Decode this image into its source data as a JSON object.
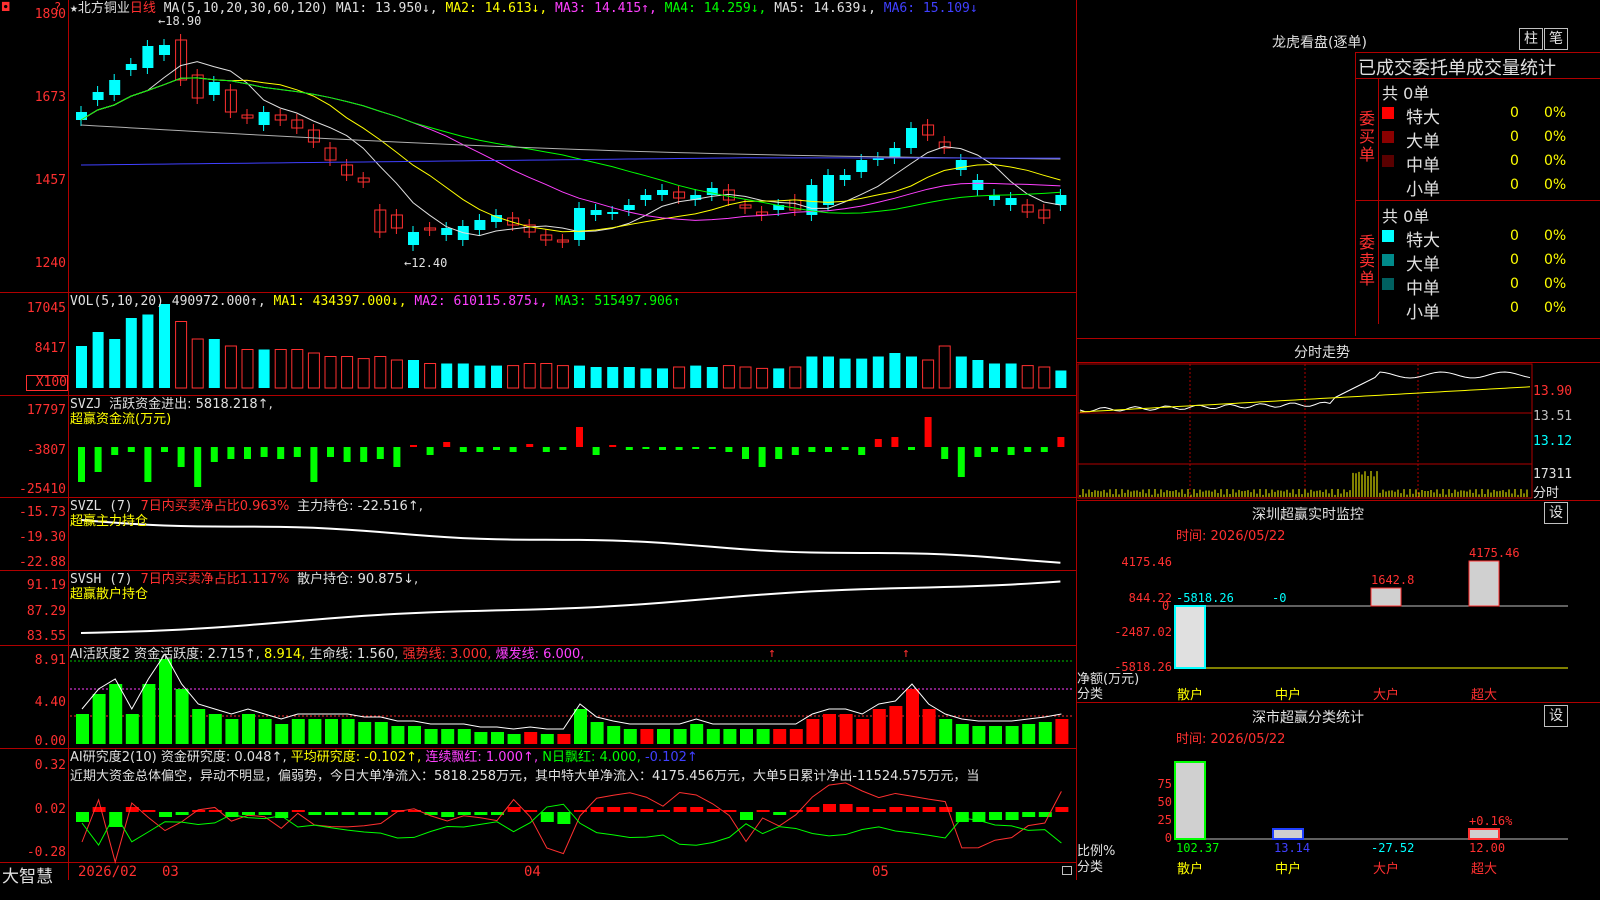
{
  "stock": {
    "star": "★",
    "name": "北方铜业",
    "period": "日线",
    "ma_label": "MA(5,10,20,30,60,120)",
    "ma1": "MA1: 13.950↓,",
    "ma2": "MA2: 14.613↓,",
    "ma3": "MA3: 14.415↑,",
    "ma4": "MA4: 14.259↓,",
    "ma5": "MA5: 14.639↓,",
    "ma6": "MA6: 15.109↓",
    "high_marker": "←18.90",
    "low_marker": "←12.40",
    "yticks": [
      "1890",
      "1673",
      "1457",
      "1240"
    ],
    "top_left_icon": "◘",
    "top_right_icon": "?"
  },
  "vol": {
    "label": "VOL(5,10,20)",
    "value": "490972.000↑,",
    "ma1": "MA1: 434397.000↓,",
    "ma2": "MA2: 610115.875↓,",
    "ma3": "MA3: 515497.906↑",
    "yticks": [
      "17045",
      "8417",
      "X100"
    ]
  },
  "svzj": {
    "label": "SVZJ",
    "value": "活跃资金进出: 5818.218↑,",
    "sub": "超赢资金流(万元)",
    "yticks": [
      "17797",
      "-3807",
      "-25410"
    ]
  },
  "svzl": {
    "label": "SVZL (7)",
    "ratio": "7日内买卖净占比0.963%",
    "hold": "主力持仓: -22.516↑,",
    "sub": "超赢主力持仓",
    "yticks": [
      "-15.73",
      "-19.30",
      "-22.88"
    ]
  },
  "svsh": {
    "label": "SVSH (7)",
    "ratio": "7日内买卖净占比1.117%",
    "hold": "散户持仓: 90.875↓,",
    "sub": "超赢散户持仓",
    "yticks": [
      "91.19",
      "87.29",
      "83.55"
    ]
  },
  "ai1": {
    "label": "AI活跃度2",
    "a": "资金活跃度: 2.715↑,",
    "b": "8.914,",
    "c": "生命线: 1.560,",
    "d": "强势线: 3.000,",
    "e": "爆发线: 6.000,",
    "yticks": [
      "8.91",
      "4.40",
      "0.00"
    ],
    "arrow": "↑"
  },
  "ai2": {
    "label": "AI研究度2(10)",
    "a": "资金研究度: 0.048↑,",
    "b": "平均研究度: -0.102↑,",
    "c": "连续飘红: 1.000↑,",
    "d": "N日飘红: 4.000,",
    "e": "-0.102↑",
    "summary": "近期大资金总体偏空，异动不明显，偏弱势，今日大单净流入：5818.258万元，其中特大单净流入：4175.456万元，大单5日累计净出-11524.575万元，当",
    "yticks": [
      "0.32",
      "0.02",
      "-0.28"
    ]
  },
  "xaxis": {
    "brand": "大智慧",
    "labels": [
      "2026/02",
      "03",
      "04",
      "05"
    ]
  },
  "right": {
    "dragon_title": "龙虎看盘(逐单)",
    "btn1": "柱",
    "btn2": "笔",
    "stats_title": "已成交委托单成交量统计",
    "buy_side": "委买单",
    "sell_side": "委卖单",
    "buy_total": "共 0单",
    "sell_total": "共 0单",
    "buy_rows": [
      {
        "label": "特大",
        "count": "0",
        "pct": "0%",
        "color": "#ff0000"
      },
      {
        "label": "大单",
        "count": "0",
        "pct": "0%",
        "color": "#8b0000"
      },
      {
        "label": "中单",
        "count": "0",
        "pct": "0%",
        "color": "#5a0000"
      },
      {
        "label": "小单",
        "count": "0",
        "pct": "0%",
        "color": "#000000"
      }
    ],
    "sell_rows": [
      {
        "label": "特大",
        "count": "0",
        "pct": "0%",
        "color": "#00ffff"
      },
      {
        "label": "大单",
        "count": "0",
        "pct": "0%",
        "color": "#008b8b"
      },
      {
        "label": "中单",
        "count": "0",
        "pct": "0%",
        "color": "#006060"
      },
      {
        "label": "小单",
        "count": "0",
        "pct": "0%",
        "color": "#000000"
      }
    ],
    "intraday_title": "分时走势",
    "intraday_yticks": [
      "13.90",
      "13.51",
      "13.12"
    ],
    "intraday_vol": "17311",
    "intraday_unit": "分时",
    "monitor_title": "深圳超赢实时监控",
    "monitor_btn": "设",
    "monitor_time": "时间: 2026/05/22",
    "monitor_yticks": [
      "4175.46",
      "844.22",
      "-2487.02",
      "-5818.26"
    ],
    "monitor_zero": "0",
    "monitor_values": {
      "sanhu": "-5818.26",
      "zhonghu": "-0",
      "dahu": "1642.8",
      "chaoda": "4175.46"
    },
    "monitor_ylabel": "净额(万元)",
    "monitor_xlabel": "分类",
    "cats": [
      "散户",
      "中户",
      "大户",
      "超大"
    ],
    "class_title": "深市超赢分类统计",
    "class_btn": "设",
    "class_time": "时间: 2026/05/22",
    "class_yticks": [
      "75",
      "50",
      "25",
      "0"
    ],
    "class_ylabel": "比例%",
    "class_xlabel": "分类",
    "class_values": [
      "102.37",
      "13.14",
      "-27.52",
      "12.00"
    ],
    "class_top_label": "+0.16%"
  },
  "colors": {
    "up": "#ff3030",
    "down": "#00ffff",
    "grid": "#b00000"
  }
}
